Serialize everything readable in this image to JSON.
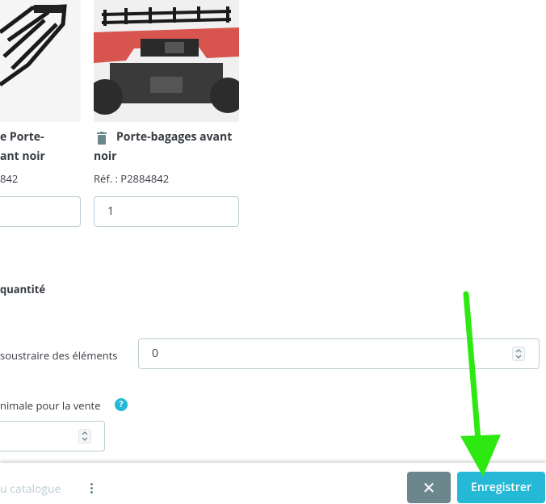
{
  "products": [
    {
      "name_line1": "e Porte-",
      "name_line2": "ant noir",
      "reference": "842",
      "image": "atv-rear-rack-photo"
    },
    {
      "delete_icon": "trash-icon",
      "name_line1": "Porte-bagages avant",
      "name_line2": "noir",
      "reference": "Réf. : P2884842",
      "quantity": "1",
      "image": "atv-front-rack-photo"
    }
  ],
  "quantity_section": {
    "title": "quantité",
    "subtract_label": "soustraire des éléments",
    "subtract_value": "0",
    "min_sale_label": "nimale pour la vente",
    "help_icon": "question-circle-icon",
    "help_glyph": "?"
  },
  "footer": {
    "catalog_link": "u catalogue",
    "more_icon": "kebab-menu-icon",
    "cancel_glyph": "✕",
    "save_label": "Enregistrer"
  },
  "colors": {
    "accent": "#25b9d7",
    "cancel": "#6c868e",
    "annotation_arrow": "#2ee812"
  }
}
